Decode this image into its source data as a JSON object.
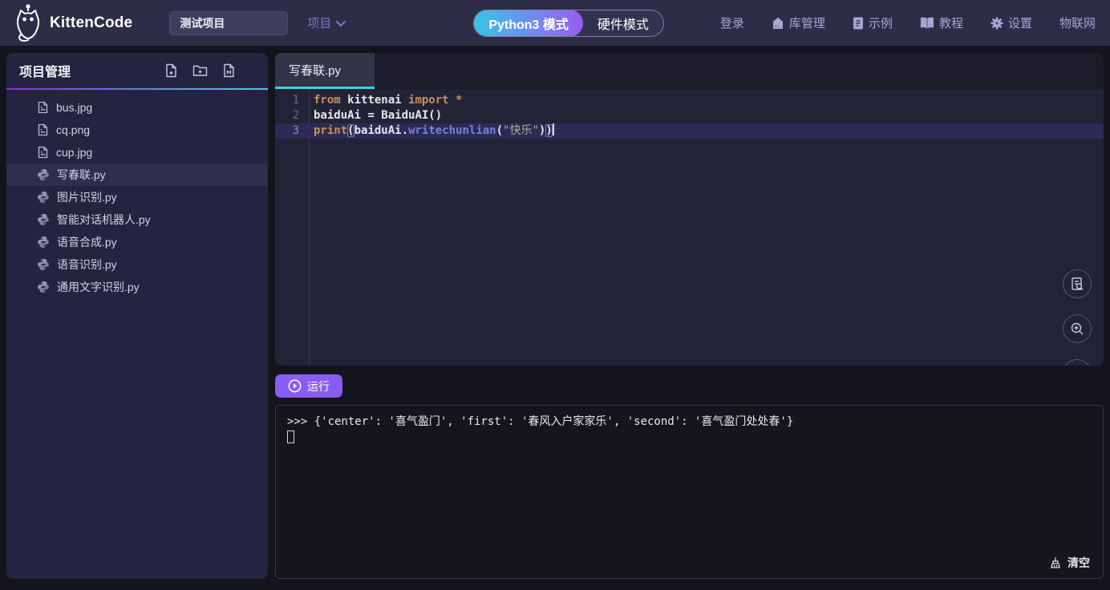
{
  "app": {
    "name": "KittenCode"
  },
  "topbar": {
    "project_name_value": "测试项目",
    "project_menu_label": "项目",
    "modes": {
      "python_label": "Python3 模式",
      "hardware_label": "硬件模式",
      "active": "python"
    },
    "nav": [
      {
        "label": "登录",
        "icon": null
      },
      {
        "label": "库管理",
        "icon": "library-icon"
      },
      {
        "label": "示例",
        "icon": "examples-icon"
      },
      {
        "label": "教程",
        "icon": "tutorial-icon"
      },
      {
        "label": "设置",
        "icon": "settings-icon"
      },
      {
        "label": "物联网",
        "icon": null
      }
    ]
  },
  "sidebar": {
    "title": "项目管理",
    "header_icons": [
      "new-file-icon",
      "new-folder-icon",
      "import-file-icon",
      "kebab-menu-icon"
    ],
    "files": [
      {
        "name": "bus.jpg",
        "type": "image",
        "selected": false,
        "menu": false
      },
      {
        "name": "cq.png",
        "type": "image",
        "selected": false,
        "menu": false
      },
      {
        "name": "cup.jpg",
        "type": "image",
        "selected": false,
        "menu": false
      },
      {
        "name": "写春联.py",
        "type": "python",
        "selected": true,
        "menu": false
      },
      {
        "name": "图片识别.py",
        "type": "python",
        "selected": false,
        "menu": false
      },
      {
        "name": "智能对话机器人.py",
        "type": "python",
        "selected": false,
        "menu": true
      },
      {
        "name": "语音合成.py",
        "type": "python",
        "selected": false,
        "menu": false
      },
      {
        "name": "语音识别.py",
        "type": "python",
        "selected": false,
        "menu": false
      },
      {
        "name": "通用文字识别.py",
        "type": "python",
        "selected": false,
        "menu": false
      }
    ]
  },
  "editor": {
    "active_tab": "写春联.py",
    "code_lines": [
      {
        "num": "1",
        "active": false,
        "tokens": [
          {
            "t": "from ",
            "c": "kw"
          },
          {
            "t": "kittenai ",
            "c": "pl"
          },
          {
            "t": "import ",
            "c": "kw"
          },
          {
            "t": "*",
            "c": "kw"
          }
        ]
      },
      {
        "num": "2",
        "active": false,
        "tokens": [
          {
            "t": "baiduAi ",
            "c": "pl"
          },
          {
            "t": "= ",
            "c": "pl"
          },
          {
            "t": "BaiduAI()",
            "c": "pl"
          }
        ]
      },
      {
        "num": "3",
        "active": true,
        "tokens": [
          {
            "t": "print",
            "c": "kw"
          },
          {
            "t": "(",
            "c": "pl br"
          },
          {
            "t": "baiduAi.",
            "c": "pl"
          },
          {
            "t": "writechunlian",
            "c": "fn"
          },
          {
            "t": "(",
            "c": "pl"
          },
          {
            "t": "\"快乐\"",
            "c": "str"
          },
          {
            "t": ")",
            "c": "pl"
          },
          {
            "t": ")",
            "c": "pl br"
          },
          {
            "t": "",
            "c": "caret"
          }
        ]
      }
    ],
    "float_buttons": [
      "format-code-icon",
      "zoom-in-icon",
      "zoom-out-icon"
    ]
  },
  "run": {
    "label": "运行"
  },
  "console": {
    "output_line": ">>> {'center': '喜气盈门', 'first': '春风入户家家乐', 'second': '喜气盈门处处春'}",
    "clear_label": "清空"
  },
  "colors": {
    "accent_purple": "#8a5cf5",
    "accent_cyan": "#3fd0e4",
    "mode_gradient_start": "#3cc3e8",
    "mode_gradient_end": "#9c5cf0",
    "topbar_bg": "#2d2d48",
    "sidebar_bg": "#242441",
    "editor_bg": "#232337",
    "console_bg": "#15151c",
    "active_line_bg": "#2d2a56",
    "keyword_color": "#c89058",
    "function_color": "#7583d6",
    "string_color": "#a4b18c"
  }
}
